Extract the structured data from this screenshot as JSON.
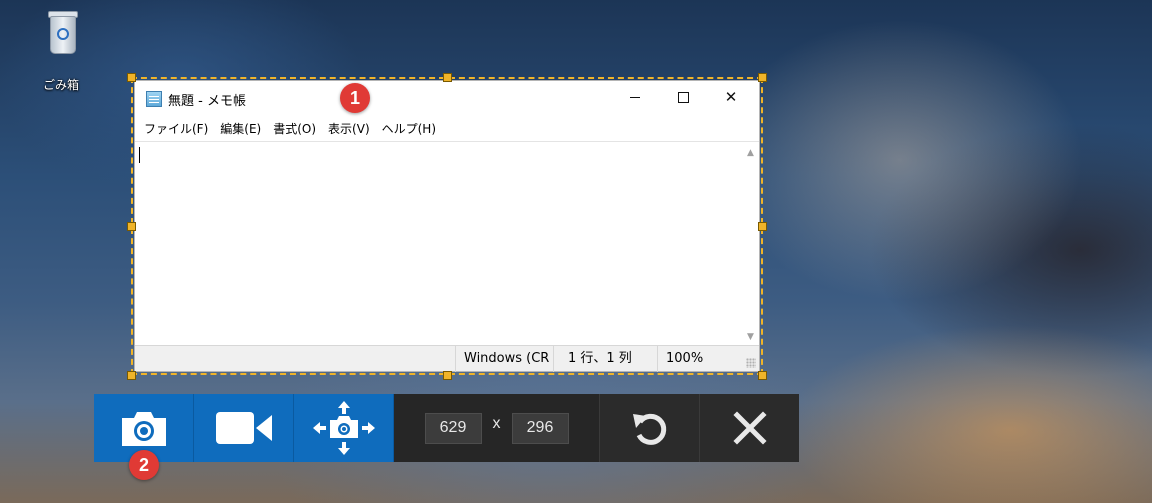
{
  "desktop": {
    "recycle_bin_label": "ごみ箱"
  },
  "notepad": {
    "title": "無題 - メモ帳",
    "min_glyph": "—",
    "max_glyph": "☐",
    "close_glyph": "✕",
    "menu": [
      "ファイル(F)",
      "編集(E)",
      "書式(O)",
      "表示(V)",
      "ヘルプ(H)"
    ],
    "editor_text": "",
    "status": {
      "encoding": "Windows (CR",
      "position": "1 行、1 列",
      "zoom": "100%"
    }
  },
  "markers": {
    "one": "1",
    "two": "2"
  },
  "toolbar": {
    "width_value": "629",
    "separator": "x",
    "height_value": "296"
  },
  "colors": {
    "selection_border": "#f0b429",
    "toolbar_blue": "#0f6cbd",
    "toolbar_dark": "#2b2b2b",
    "marker_red": "#e03a35"
  }
}
